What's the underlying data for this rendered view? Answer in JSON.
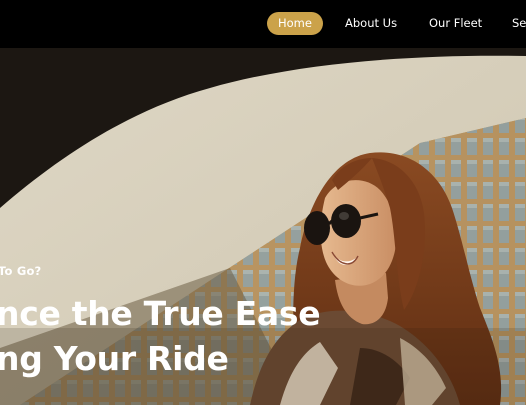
{
  "nav": {
    "items": [
      {
        "label": "Home",
        "active": true
      },
      {
        "label": "About Us",
        "active": false
      },
      {
        "label": "Our Fleet",
        "active": false
      },
      {
        "label": "Ser",
        "active": false
      }
    ]
  },
  "hero": {
    "kicker": "To Go?",
    "headline_line1": "nce the True Ease",
    "headline_line2": "ng Your Ride",
    "image_subject": "smiling woman with sunglasses and long auburn hair in front of a building facade"
  },
  "colors": {
    "nav_background": "#000000",
    "accent": "#cba24a",
    "text": "#ffffff"
  }
}
